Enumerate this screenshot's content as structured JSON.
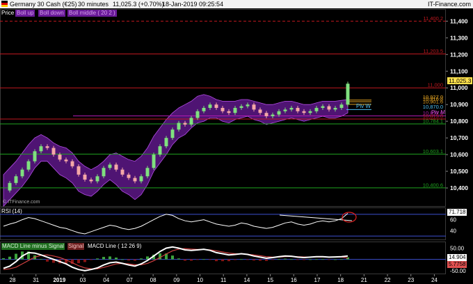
{
  "header": {
    "instrument": "Germany 30 Cash (€25)",
    "timeframe": "30 minutes",
    "quote": "11,025.3 (+0.70%)",
    "datetime": "18-Jan-2019 09:25:54",
    "brand": "IT-Finance.com"
  },
  "price_panel": {
    "title": "Price",
    "bollinger_legend": [
      "Boll up",
      "Boll down",
      "Boll middle ( 20 2 )"
    ],
    "watermark": "© ITFinance.com",
    "price_tag": "11,025.3",
    "pivot_w_label": "Piv W",
    "pivot_m_label": "Piv M"
  },
  "rsi_panel": {
    "title": "RSI (14)",
    "value_tag": "71.718"
  },
  "macd_panel": {
    "legend": [
      "MACD Line minus Signal",
      "Signal",
      "MACD Line ( 12 26 9)"
    ],
    "value_tag_1": "14.904",
    "value_tag_2": "5.7758"
  },
  "colors": {
    "candle_up": "#7fe07f",
    "candle_down": "#f4a7a7",
    "band_fill": "#6a1b9a",
    "band_line": "#b34de6",
    "resistance": "#c0181f",
    "support": "#1fa31f",
    "pivot": "#b21bb2",
    "pivot_w": "#4fc3f7",
    "rsi_line": "#ffffff",
    "macd_line": "#ffffff",
    "signal": "#d04040",
    "hist_pos": "#3ca33c",
    "hist_neg": "#8a1515"
  },
  "chart_data": [
    {
      "type": "line",
      "panel": "price",
      "title": "Germany 30 Cash (€25) — 30 minutes",
      "x_dates": [
        "28",
        "31",
        "2019",
        "03",
        "04",
        "07",
        "08",
        "09",
        "10",
        "11",
        "14",
        "15",
        "16",
        "17",
        "18",
        "21",
        "22",
        "23",
        "24"
      ],
      "y_ticks": [
        11400,
        11300,
        11200,
        11100,
        11000,
        10900,
        10800,
        10700,
        10600,
        10500,
        10400
      ],
      "ylim": [
        10300,
        11460
      ],
      "series": [
        {
          "name": "Price",
          "values": [
            10385,
            10430,
            10470,
            10510,
            10560,
            10620,
            10650,
            10640,
            10600,
            10570,
            10560,
            10530,
            10480,
            10450,
            10440,
            10470,
            10520,
            10540,
            10510,
            10480,
            10460,
            10440,
            10470,
            10520,
            10600,
            10650,
            10700,
            10750,
            10790,
            10780,
            10820,
            10860,
            10880,
            10900,
            10880,
            10860,
            10850,
            10880,
            10890,
            10900,
            10870,
            10850,
            10830,
            10840,
            10860,
            10870,
            10880,
            10860,
            10850,
            10860,
            10880,
            10890,
            10870,
            10880,
            10900,
            11025
          ]
        }
      ],
      "bollinger": {
        "upper": [
          10480,
          10520,
          10560,
          10610,
          10660,
          10700,
          10720,
          10700,
          10670,
          10650,
          10640,
          10610,
          10560,
          10530,
          10510,
          10530,
          10560,
          10600,
          10610,
          10590,
          10570,
          10560,
          10590,
          10640,
          10710,
          10760,
          10810,
          10850,
          10880,
          10900,
          10920,
          10950,
          10960,
          10950,
          10930,
          10920,
          10920,
          10920,
          10930,
          10930,
          10920,
          10910,
          10900,
          10900,
          10910,
          10920,
          10920,
          10910,
          10900,
          10900,
          10910,
          10920,
          10920,
          10920,
          10925,
          10930
        ],
        "lower": [
          10290,
          10330,
          10370,
          10410,
          10460,
          10520,
          10560,
          10560,
          10520,
          10480,
          10460,
          10430,
          10380,
          10360,
          10350,
          10380,
          10420,
          10450,
          10420,
          10380,
          10360,
          10330,
          10360,
          10420,
          10500,
          10550,
          10600,
          10660,
          10700,
          10720,
          10760,
          10790,
          10800,
          10820,
          10820,
          10800,
          10790,
          10810,
          10820,
          10830,
          10810,
          10800,
          10780,
          10790,
          10800,
          10810,
          10820,
          10810,
          10800,
          10810,
          10820,
          10830,
          10820,
          10820,
          10830,
          10850
        ]
      },
      "levels": [
        {
          "value": 11400.2,
          "label": "11,400.2",
          "kind": "resistance",
          "style": "dashed"
        },
        {
          "value": 11203.5,
          "label": "11,203.5",
          "kind": "resistance",
          "style": "solid"
        },
        {
          "value": 11000.0,
          "label": "11,000",
          "kind": "resistance",
          "style": "solid"
        },
        {
          "value": 10927.0,
          "label": "10,927.0",
          "kind": "pivot",
          "style": "solid"
        },
        {
          "value": 10916.8,
          "label": "10,916.8",
          "kind": "pivot",
          "style": "solid"
        },
        {
          "value": 10901.6,
          "label": "10,901.6",
          "kind": "pivot",
          "style": "solid"
        },
        {
          "value": 10870.0,
          "label": "10,870.0",
          "kind": "pivot_w",
          "style": "solid"
        },
        {
          "value": 10832.0,
          "label": "10,832.0",
          "kind": "pivot_m",
          "style": "solid"
        },
        {
          "value": 10813.0,
          "label": "10,813.0",
          "kind": "resistance",
          "style": "solid"
        },
        {
          "value": 10784.1,
          "label": "10,784.1",
          "kind": "support",
          "style": "solid"
        },
        {
          "value": 10603.1,
          "label": "10,603.1",
          "kind": "support",
          "style": "solid"
        },
        {
          "value": 10400.6,
          "label": "10,400.6",
          "kind": "support",
          "style": "solid"
        }
      ]
    },
    {
      "type": "line",
      "panel": "rsi",
      "title": "RSI (14)",
      "y_ticks": [
        71.718,
        60,
        40
      ],
      "ylim": [
        25,
        80
      ],
      "series": [
        {
          "name": "RSI (14)",
          "values": [
            48,
            52,
            55,
            60,
            64,
            62,
            58,
            54,
            50,
            46,
            44,
            40,
            36,
            34,
            38,
            42,
            46,
            50,
            48,
            44,
            42,
            44,
            48,
            54,
            60,
            66,
            70,
            68,
            62,
            58,
            56,
            58,
            60,
            56,
            52,
            50,
            48,
            50,
            54,
            52,
            48,
            46,
            44,
            46,
            50,
            54,
            56,
            52,
            50,
            52,
            56,
            58,
            56,
            58,
            62,
            71.718
          ]
        }
      ],
      "levels": [
        70,
        30
      ]
    },
    {
      "type": "line",
      "panel": "macd",
      "title": "MACD Line minus Signal / Signal / MACD Line ( 12 26 9)",
      "y_ticks": [
        50,
        14.904,
        5.7758,
        -50
      ],
      "ylim": [
        -60,
        70
      ],
      "series": [
        {
          "name": "MACD Line ( 12 26 9)",
          "values": [
            -40,
            -30,
            -10,
            15,
            30,
            28,
            20,
            10,
            0,
            -10,
            -20,
            -35,
            -45,
            -50,
            -45,
            -38,
            -25,
            -15,
            -12,
            -18,
            -25,
            -30,
            -20,
            -5,
            15,
            35,
            50,
            55,
            50,
            42,
            40,
            42,
            45,
            40,
            30,
            25,
            20,
            22,
            25,
            22,
            15,
            10,
            5,
            8,
            12,
            15,
            14,
            10,
            8,
            10,
            12,
            12,
            10,
            11,
            12,
            14.904
          ]
        },
        {
          "name": "Signal",
          "values": [
            -45,
            -42,
            -35,
            -20,
            -5,
            10,
            18,
            20,
            15,
            8,
            -2,
            -15,
            -28,
            -38,
            -42,
            -42,
            -36,
            -28,
            -20,
            -18,
            -20,
            -24,
            -24,
            -18,
            -6,
            8,
            24,
            38,
            46,
            48,
            46,
            44,
            44,
            42,
            38,
            33,
            28,
            25,
            24,
            23,
            20,
            16,
            12,
            10,
            10,
            12,
            13,
            12,
            11,
            10,
            11,
            11,
            11,
            11,
            11,
            5.7758
          ]
        }
      ]
    }
  ]
}
